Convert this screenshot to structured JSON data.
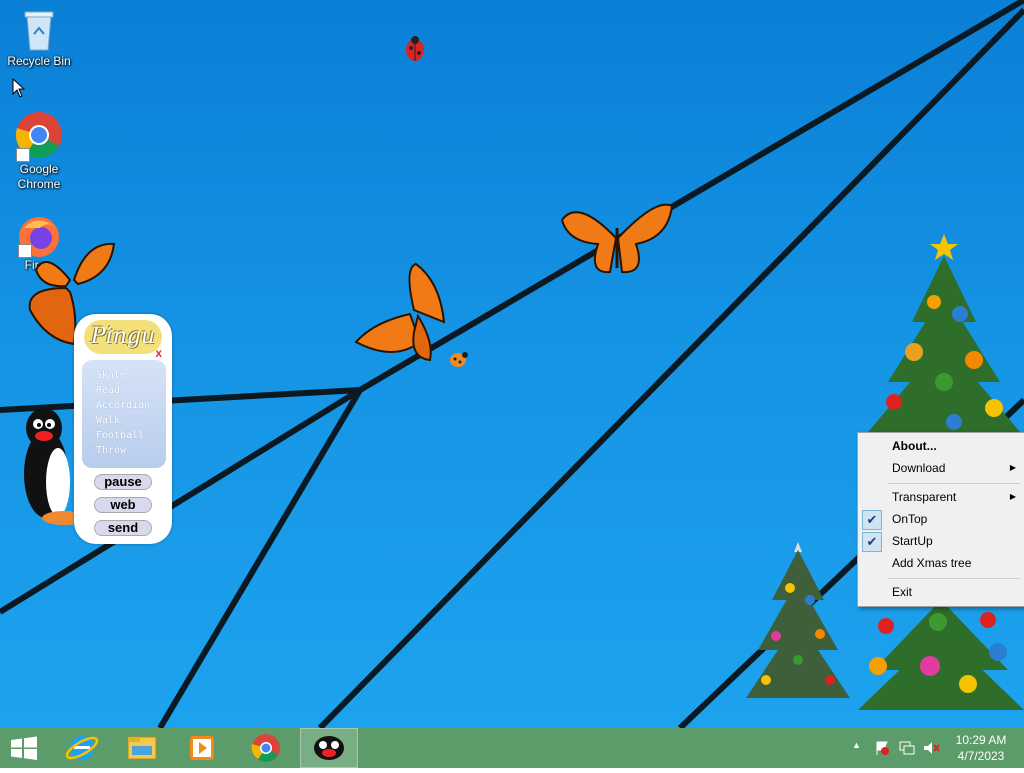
{
  "desktop_icons": [
    {
      "label": "Recycle Bin",
      "icon": "recycle-bin-icon"
    },
    {
      "label": "Google Chrome",
      "icon": "chrome-icon"
    },
    {
      "label": "Fire",
      "icon": "firefox-icon"
    }
  ],
  "pingu_panel": {
    "title": "Pingu",
    "close": "x",
    "actions": [
      "Skate",
      "Read",
      "Accordian",
      "Walk",
      "Football",
      "Throw"
    ],
    "buttons": {
      "pause": "pause",
      "web": "web",
      "send": "send"
    }
  },
  "context_menu": {
    "items": [
      {
        "label": "About...",
        "bold": true
      },
      {
        "label": "Download",
        "submenu": true
      },
      {
        "label": "Transparent",
        "submenu": true
      },
      {
        "label": "OnTop",
        "checked": true
      },
      {
        "label": "StartUp",
        "checked": true
      },
      {
        "label": "Add Xmas tree"
      },
      {
        "label": "Exit"
      }
    ],
    "arrow": "▶",
    "check": "✔"
  },
  "taskbar": {
    "apps": [
      "start-icon",
      "internet-explorer-icon",
      "file-explorer-icon",
      "media-player-icon",
      "chrome-icon",
      "pingu-app-icon"
    ],
    "tray": {
      "show_hidden": "▲"
    },
    "clock": {
      "time": "10:29 AM",
      "date": "4/7/2023"
    }
  },
  "colors": {
    "desktop": "#1a8fe0",
    "taskbar": "#5c9c6a",
    "menu_bg": "#f0f0f0"
  }
}
